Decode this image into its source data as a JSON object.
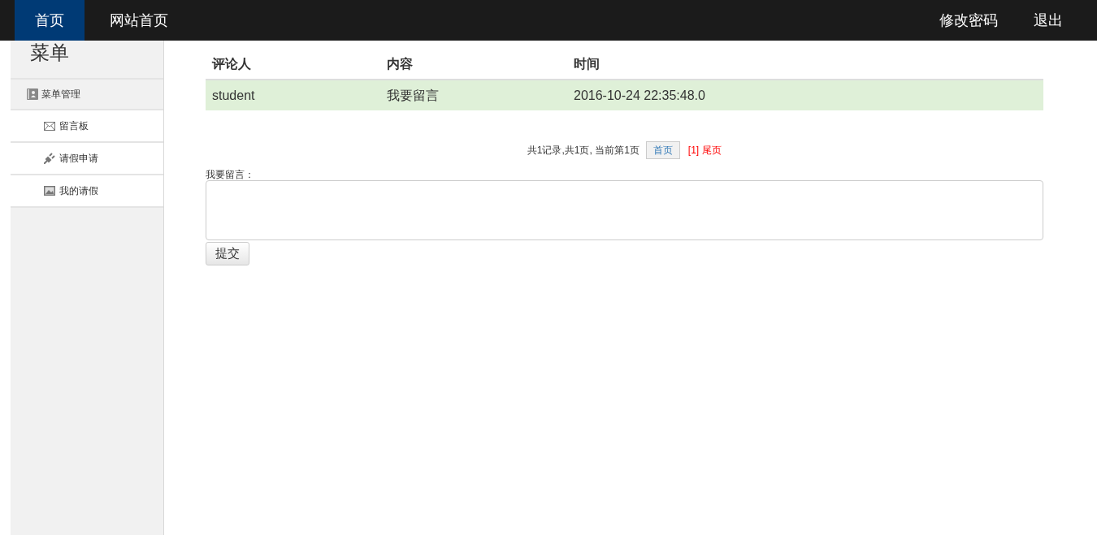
{
  "navbar": {
    "left": [
      {
        "label": "首页",
        "selected": true
      },
      {
        "label": "网站首页",
        "selected": false
      }
    ],
    "right": [
      "修改密码",
      "退出"
    ]
  },
  "sidebar": {
    "title": "菜单",
    "group": "菜单管理",
    "items": [
      {
        "label": "留言板",
        "kind": "envelope"
      },
      {
        "label": "请假申请",
        "kind": "plug"
      },
      {
        "label": "我的请假",
        "kind": "picture"
      }
    ]
  },
  "table": {
    "columns": [
      "评论人",
      "内容",
      "时间"
    ],
    "rows": [
      [
        "student",
        "我要留言",
        "2016-10-24 22:35:48.0"
      ]
    ]
  },
  "pagination": {
    "summary": "共1记录,共1页, 当前第1页",
    "first": "首页",
    "current": "[1]",
    "last": "尾页"
  },
  "form": {
    "label": "我要留言：",
    "submit": "提交"
  }
}
